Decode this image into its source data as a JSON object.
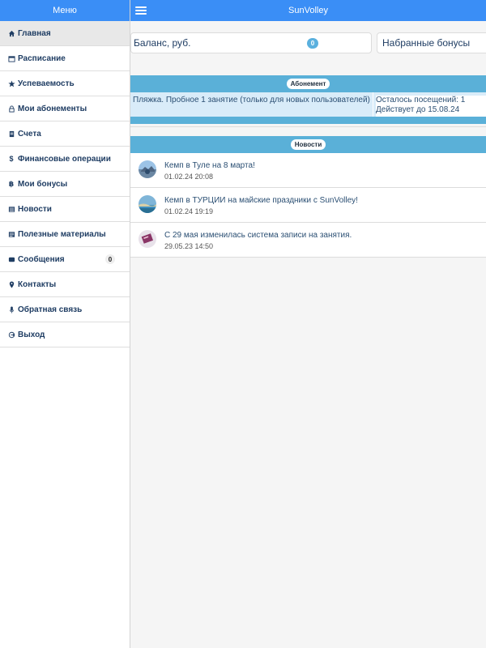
{
  "sidebar": {
    "header": "Меню",
    "items": [
      {
        "label": "Главная",
        "icon": "home-icon",
        "active": true
      },
      {
        "label": "Расписание",
        "icon": "calendar-icon"
      },
      {
        "label": "Успеваемость",
        "icon": "star-icon"
      },
      {
        "label": "Мои абонементы",
        "icon": "lock-icon"
      },
      {
        "label": "Счета",
        "icon": "invoice-icon"
      },
      {
        "label": "Финансовые операции",
        "icon": "dollar-icon"
      },
      {
        "label": "Мои бонусы",
        "icon": "bitcoin-icon"
      },
      {
        "label": "Новости",
        "icon": "list-icon"
      },
      {
        "label": "Полезные материалы",
        "icon": "book-icon"
      },
      {
        "label": "Сообщения",
        "icon": "message-icon",
        "badge": "0"
      },
      {
        "label": "Контакты",
        "icon": "map-marker-icon"
      },
      {
        "label": "Обратная связь",
        "icon": "microphone-icon"
      },
      {
        "label": "Выход",
        "icon": "logout-icon"
      }
    ]
  },
  "topbar": {
    "title": "SunVolley"
  },
  "balance": {
    "label": "Баланс, руб.",
    "count": "0"
  },
  "bonuses": {
    "label": "Набранные бонусы"
  },
  "subscription": {
    "section_label": "Абонемент",
    "name": "Пляжка. Пробное 1 занятие (только для новых пользователей)",
    "remaining": "Осталось посещений: 1",
    "valid_until": "Действует до 15.08.24"
  },
  "news": {
    "section_label": "Новости",
    "items": [
      {
        "title": "Кемп в Туле на 8 марта!",
        "date": "01.02.24 20:08"
      },
      {
        "title": "Кемп в ТУРЦИИ на майские праздники с SunVolley!",
        "date": "01.02.24 19:19"
      },
      {
        "title": "С 29 мая изменилась система записи на занятия.",
        "date": "29.05.23 14:50"
      }
    ]
  },
  "colors": {
    "accent": "#3a8ef6",
    "section": "#5ab0d8",
    "text": "#1f3d63"
  }
}
